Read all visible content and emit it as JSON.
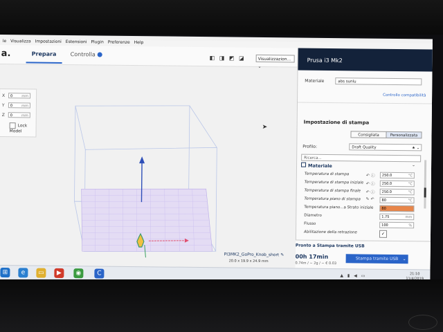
{
  "menu": [
    "Visualizza",
    "Impostazioni",
    "Estensioni",
    "Plugin",
    "Preferenze",
    "Help"
  ],
  "menu_prefix": "le",
  "app": {
    "logo": "a."
  },
  "tabs": {
    "prepare": "Prepara",
    "monitor": "Controlla"
  },
  "view": {
    "icons": "◧ ◨ ◩ ◪",
    "dropdown": "Visualizzazion...",
    "chevron": "⌄"
  },
  "position": {
    "x_label": "X",
    "x_value": "0",
    "y_label": "Y",
    "y_value": "0",
    "z_label": "Z",
    "z_value": "0",
    "unit": "mm",
    "lock_model": "Lock Model"
  },
  "object": {
    "name": "PI3MK2_GoPro_Knob_short",
    "dimensions": "20.0 x 19.9 x 24.9 mm",
    "edit_icon": "✎"
  },
  "panel": {
    "printer": "Prusa i3 Mk2",
    "material_label": "Materiale",
    "material_value": "abs sunlu",
    "compat_link": "Controllo compatibilità",
    "print_settings_title": "Impostazione di stampa",
    "recommended": "Consigliata",
    "custom": "Personalizzata",
    "profile_label": "Profilo:",
    "profile_value": "Draft Quality",
    "profile_icons": "★ ⌄",
    "search_placeholder": "Ricerca...",
    "material_section": "Materiale",
    "collapse": "⌄"
  },
  "settings": [
    {
      "label": "Temperatura di stampa",
      "icons": "↶ ⓘ",
      "value": "250.0",
      "unit": "°C",
      "warn": false
    },
    {
      "label": "Temperatura di stampa iniziale",
      "icons": "↶ ⓘ",
      "value": "250.0",
      "unit": "°C",
      "warn": false
    },
    {
      "label": "Temperatura di stampa finale",
      "icons": "↶ ⓘ",
      "value": "250.0",
      "unit": "°C",
      "warn": false
    },
    {
      "label": "Temperatura piano di stampa",
      "icons": "✎ ↶",
      "value": "80",
      "unit": "°C",
      "warn": false
    },
    {
      "label": "Temperatura piano...a Strato iniziale",
      "icons": "",
      "value": "80",
      "unit": "",
      "warn": true
    },
    {
      "label": "Diametro",
      "icons": "",
      "value": "1.75",
      "unit": "mm",
      "warn": false
    },
    {
      "label": "Flusso",
      "icons": "",
      "value": "100",
      "unit": "%",
      "warn": false
    }
  ],
  "retraction": {
    "label": "Abilitazione della retrazione",
    "checked": "✓"
  },
  "print": {
    "ready": "Pronto a Stampa tramite USB",
    "time": "00h 17min",
    "stats": "0.74m / ~ 2g / ~ € 0.03",
    "button": "Stampa tramite USB",
    "button_icon": "⌄"
  },
  "taskbar": {
    "tray": "▲ ▮ ◀ ▭",
    "time": "21:10",
    "date": "11/4/2019"
  },
  "colors": {
    "accent": "#2a64c8",
    "header": "#13223a",
    "warn": "#e8864a",
    "grid": "#b7a8e8"
  }
}
